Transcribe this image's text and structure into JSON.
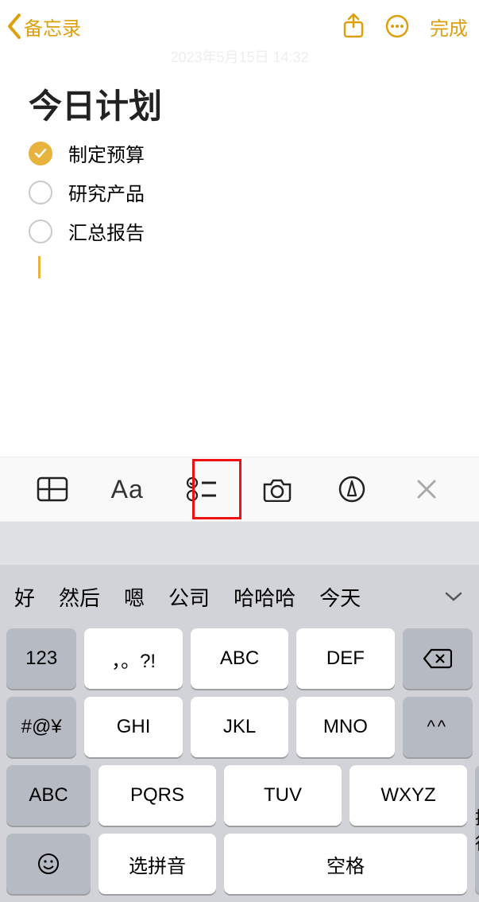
{
  "nav": {
    "back_label": "备忘录",
    "done_label": "完成"
  },
  "timestamp": "2023年5月15日 14:32",
  "note": {
    "title": "今日计划",
    "items": [
      {
        "text": "制定预算",
        "checked": true
      },
      {
        "text": "研究产品",
        "checked": false
      },
      {
        "text": "汇总报告",
        "checked": false
      }
    ]
  },
  "toolbar": {
    "aa": "Aa"
  },
  "candidates": [
    "好",
    "然后",
    "嗯",
    "公司",
    "哈哈哈",
    "今天"
  ],
  "keys": {
    "r1": {
      "side": "123",
      "a": "，。?!",
      "b": "ABC",
      "c": "DEF"
    },
    "r2": {
      "side": "#@¥",
      "a": "GHI",
      "b": "JKL",
      "c": "MNO",
      "face": "^^"
    },
    "r3": {
      "side": "ABC",
      "a": "PQRS",
      "b": "TUV",
      "c": "WXYZ"
    },
    "r4": {
      "sel": "选拼音",
      "space": "空格",
      "enter": "换行"
    }
  }
}
